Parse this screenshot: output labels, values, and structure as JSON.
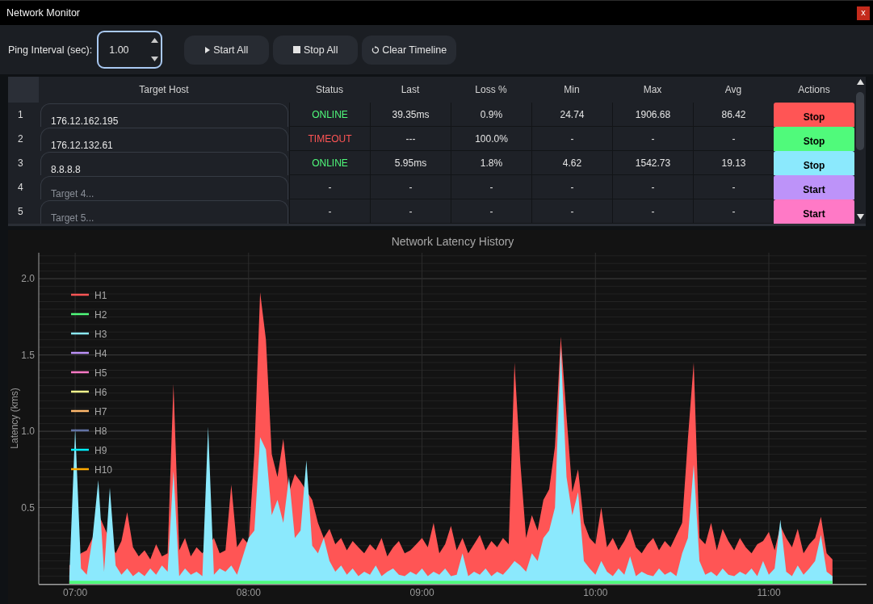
{
  "window": {
    "title": "Network Monitor",
    "close": "x"
  },
  "toolbar": {
    "interval": {
      "label": "Ping Interval (sec):",
      "value": "1.00",
      "focused": true
    },
    "buttons": [
      {
        "kind": "start",
        "label": "Start All"
      },
      {
        "kind": "stop",
        "label": "Stop All"
      },
      {
        "kind": "clear",
        "label": "Clear Timeline"
      }
    ]
  },
  "table": {
    "columns": [
      "Target Host",
      "Status",
      "Last",
      "Loss %",
      "Min",
      "Max",
      "Avg",
      "Actions"
    ],
    "rows": [
      {
        "number": "1",
        "host": "176.12.162.195",
        "status": {
          "text": "ONLINE",
          "color": "#50fa7b"
        },
        "last": "39.35ms",
        "loss": "0.9%",
        "min": "24.74",
        "max": "1906.68",
        "avg": "86.42",
        "action": "Stop",
        "color": "#ff5555"
      },
      {
        "number": "2",
        "host": "176.12.132.61",
        "status": {
          "text": "TIMEOUT",
          "color": "#ff5555"
        },
        "last": "---",
        "loss": "100.0%",
        "min": "-",
        "max": "-",
        "avg": "-",
        "action": "Stop",
        "color": "#50fa7b"
      },
      {
        "number": "3",
        "host": "8.8.8.8",
        "status": {
          "text": "ONLINE",
          "color": "#50fa7b"
        },
        "last": "5.95ms",
        "loss": "1.8%",
        "min": "4.62",
        "max": "1542.73",
        "avg": "19.13",
        "action": "Stop",
        "color": "#8be9fd"
      },
      {
        "number": "4",
        "placeholder": "Target 4...",
        "status": {
          "text": "-"
        },
        "last": "-",
        "loss": "-",
        "min": "-",
        "max": "-",
        "avg": "-",
        "action": "Start",
        "color": "#bd93f9"
      },
      {
        "number": "5",
        "placeholder": "Target 5...",
        "status": {
          "text": "-"
        },
        "last": "-",
        "loss": "-",
        "min": "-",
        "max": "-",
        "avg": "-",
        "action": "Start",
        "color": "#ff79c6"
      }
    ]
  },
  "chart": {
    "chart_data": {
      "type": "area",
      "title": "Network Latency History",
      "ylabel": "Latency (kms)",
      "grid": true,
      "legend": "upper left",
      "categories": [
        null,
        "07:00",
        null,
        null,
        null,
        null,
        null,
        null,
        null,
        null,
        null,
        null,
        null,
        null,
        null,
        null,
        null,
        null,
        null,
        null,
        null,
        null,
        null,
        null,
        null,
        null,
        null,
        null,
        null,
        null,
        null,
        "08:00",
        null,
        null,
        null,
        null,
        null,
        null,
        null,
        null,
        null,
        null,
        null,
        null,
        null,
        null,
        null,
        null,
        null,
        null,
        null,
        null,
        null,
        null,
        null,
        null,
        null,
        null,
        null,
        null,
        null,
        "09:00",
        null,
        null,
        null,
        null,
        null,
        null,
        null,
        null,
        null,
        null,
        null,
        null,
        null,
        null,
        null,
        null,
        null,
        null,
        null,
        null,
        null,
        null,
        null,
        null,
        null,
        null,
        null,
        null,
        null,
        "10:00",
        null,
        null,
        null,
        null,
        null,
        null,
        null,
        null,
        null,
        null,
        null,
        null,
        null,
        null,
        null,
        null,
        null,
        null,
        null,
        null,
        null,
        null,
        null,
        null,
        null,
        null,
        null,
        null,
        null,
        "11:00",
        null,
        null,
        null,
        null,
        null,
        null,
        null,
        null,
        null,
        null,
        null
      ],
      "series": [
        {
          "name": "H1",
          "color": "#ff5555",
          "values": [
            0.12,
            null,
            0.2,
            0.22,
            0.3,
            0.46,
            null,
            null,
            0.2,
            0.28,
            0.47,
            0.24,
            0.18,
            0.22,
            0.16,
            0.26,
            0.18,
            0.2,
            1.31,
            0.22,
            0.3,
            0.18,
            0.24,
            0.2,
            null,
            0.3,
            0.2,
            0.22,
            0.65,
            0.24,
            0.3,
            0.26,
            0.86,
            1.91,
            1.6,
            0.85,
            0.7,
            0.95,
            0.6,
            0.72,
            0.67,
            null,
            0.55,
            0.4,
            0.3,
            0.36,
            0.26,
            0.3,
            0.22,
            0.28,
            0.24,
            0.2,
            0.26,
            0.22,
            0.3,
            0.18,
            0.24,
            0.28,
            0.2,
            0.22,
            0.26,
            0.3,
            0.24,
            0.4,
            0.2,
            0.26,
            0.38,
            0.22,
            0.3,
            0.2,
            0.26,
            0.32,
            0.22,
            0.28,
            0.24,
            0.3,
            0.26,
            1.45,
            0.8,
            0.3,
            0.45,
            0.35,
            0.55,
            0.62,
            0.9,
            1.62,
            1.1,
            0.6,
            0.75,
            0.4,
            0.3,
            0.26,
            0.5,
            0.24,
            0.3,
            0.22,
            0.28,
            0.36,
            0.24,
            0.2,
            0.26,
            0.3,
            0.22,
            0.28,
            0.24,
            0.32,
            0.4,
            0.95,
            1.45,
            0.3,
            0.26,
            0.4,
            0.22,
            0.36,
            0.28,
            0.22,
            0.3,
            0.24,
            0.2,
            0.26,
            0.28,
            0.34,
            0.22,
            0.38,
            0.3,
            0.24,
            0.36,
            0.2,
            0.26,
            0.3,
            0.44,
            0.2,
            0.16
          ]
        },
        {
          "name": "H2",
          "color": "#50fa7b",
          "values": [
            0.02,
            0.02,
            0.02,
            0.02,
            0.02,
            0.02,
            0.02,
            0.02,
            0.02,
            0.02,
            0.02,
            0.02,
            0.02,
            0.02,
            0.02,
            0.02,
            0.02,
            0.02,
            0.02,
            0.02,
            0.02,
            0.02,
            0.02,
            0.02,
            0.02,
            0.02,
            0.02,
            0.02,
            0.02,
            0.02,
            0.02,
            0.02,
            0.02,
            0.02,
            0.02,
            0.02,
            0.02,
            0.02,
            0.02,
            0.02,
            0.02,
            0.02,
            0.02,
            0.02,
            0.02,
            0.02,
            0.02,
            0.02,
            0.02,
            0.02,
            0.02,
            0.02,
            0.02,
            0.02,
            0.02,
            0.02,
            0.02,
            0.02,
            0.02,
            0.02,
            0.02,
            0.02,
            0.02,
            0.02,
            0.02,
            0.02,
            0.02,
            0.02,
            0.02,
            0.02,
            0.02,
            0.02,
            0.02,
            0.02,
            0.02,
            0.02,
            0.02,
            0.02,
            0.02,
            0.02,
            0.02,
            0.02,
            0.02,
            0.02,
            0.02,
            0.02,
            0.02,
            0.02,
            0.02,
            0.02,
            0.02,
            0.02,
            0.02,
            0.02,
            0.02,
            0.02,
            0.02,
            0.02,
            0.02,
            0.02,
            0.02,
            0.02,
            0.02,
            0.02,
            0.02,
            0.02,
            0.02,
            0.02,
            0.02,
            0.02,
            0.02,
            0.02,
            0.02,
            0.02,
            0.02,
            0.02,
            0.02,
            0.02,
            0.02,
            0.02,
            0.02,
            0.02,
            0.02,
            0.02,
            0.02,
            0.02,
            0.02,
            0.02,
            0.02,
            0.02,
            0.02,
            0.02,
            0.02
          ]
        },
        {
          "name": "H3",
          "color": "#8be9fd",
          "values": [
            0.05,
            1.02,
            0.1,
            0.06,
            0.3,
            0.68,
            0.08,
            0.63,
            0.12,
            0.06,
            0.1,
            0.05,
            0.08,
            0.05,
            0.1,
            0.06,
            0.12,
            0.08,
            0.74,
            0.05,
            0.1,
            0.06,
            0.08,
            0.05,
            1.03,
            0.06,
            0.1,
            0.08,
            0.12,
            0.06,
            0.18,
            0.3,
            0.35,
            0.96,
            0.88,
            0.45,
            0.55,
            0.4,
            0.7,
            0.3,
            0.35,
            0.81,
            0.25,
            0.2,
            0.3,
            0.15,
            0.08,
            0.12,
            0.06,
            0.1,
            0.05,
            0.08,
            0.06,
            0.12,
            0.05,
            0.08,
            0.1,
            0.06,
            0.05,
            0.08,
            0.06,
            0.1,
            0.05,
            0.08,
            0.06,
            0.1,
            0.05,
            0.06,
            0.2,
            0.05,
            0.08,
            0.06,
            0.1,
            0.05,
            0.08,
            0.06,
            0.1,
            0.15,
            0.12,
            0.08,
            0.2,
            0.15,
            0.3,
            0.35,
            0.5,
            1.55,
            0.7,
            0.45,
            0.6,
            0.15,
            0.1,
            0.06,
            0.15,
            0.08,
            0.05,
            0.1,
            0.06,
            0.18,
            0.05,
            0.08,
            0.06,
            0.05,
            0.1,
            0.06,
            0.08,
            0.05,
            0.2,
            0.3,
            0.78,
            0.15,
            0.06,
            0.08,
            0.05,
            0.1,
            0.06,
            0.05,
            0.08,
            0.06,
            0.1,
            0.05,
            0.15,
            0.06,
            0.1,
            0.42,
            0.08,
            0.05,
            0.12,
            0.06,
            0.1,
            0.15,
            0.32,
            0.08,
            0.05
          ]
        },
        {
          "name": "H4",
          "color": "#bd93f9",
          "values": [
            null,
            null,
            null,
            null,
            null,
            null,
            null,
            null,
            null,
            null,
            null,
            null,
            null,
            null,
            null,
            null,
            null,
            null,
            null,
            null,
            null,
            null,
            null,
            null,
            null,
            null,
            null,
            null,
            null,
            null,
            null,
            null,
            null,
            null,
            null,
            null,
            null,
            null,
            null,
            null,
            null,
            null,
            null,
            null,
            null,
            null,
            null,
            null,
            null,
            null,
            null,
            null,
            null,
            null,
            null,
            null,
            null,
            null,
            null,
            null,
            null,
            null,
            null,
            null,
            null,
            null,
            null,
            null,
            null,
            null,
            null,
            null,
            null,
            null,
            null,
            null,
            null,
            null,
            null,
            null,
            null,
            null,
            null,
            null,
            null,
            null,
            null,
            null,
            null,
            null,
            null,
            null,
            null,
            null,
            null,
            null,
            null,
            null,
            null,
            null,
            null,
            null,
            null,
            null,
            null,
            null,
            null,
            null,
            null,
            null,
            null,
            null,
            null,
            null,
            null,
            null,
            null,
            null,
            null,
            null,
            null,
            null,
            null,
            null,
            null,
            null,
            null,
            null,
            null,
            null,
            null,
            null,
            null
          ]
        },
        {
          "name": "H5",
          "color": "#ff79c6",
          "values": [
            null,
            null,
            null,
            null,
            null,
            null,
            null,
            null,
            null,
            null,
            null,
            null,
            null,
            null,
            null,
            null,
            null,
            null,
            null,
            null,
            null,
            null,
            null,
            null,
            null,
            null,
            null,
            null,
            null,
            null,
            null,
            null,
            null,
            null,
            null,
            null,
            null,
            null,
            null,
            null,
            null,
            null,
            null,
            null,
            null,
            null,
            null,
            null,
            null,
            null,
            null,
            null,
            null,
            null,
            null,
            null,
            null,
            null,
            null,
            null,
            null,
            null,
            null,
            null,
            null,
            null,
            null,
            null,
            null,
            null,
            null,
            null,
            null,
            null,
            null,
            null,
            null,
            null,
            null,
            null,
            null,
            null,
            null,
            null,
            null,
            null,
            null,
            null,
            null,
            null,
            null,
            null,
            null,
            null,
            null,
            null,
            null,
            null,
            null,
            null,
            null,
            null,
            null,
            null,
            null,
            null,
            null,
            null,
            null,
            null,
            null,
            null,
            null,
            null,
            null,
            null,
            null,
            null,
            null,
            null,
            null,
            null,
            null,
            null,
            null,
            null,
            null,
            null,
            null,
            null,
            null,
            null,
            null
          ]
        },
        {
          "name": "H6",
          "color": "#f1fa8c",
          "values": [
            null,
            null,
            null,
            null,
            null,
            null,
            null,
            null,
            null,
            null,
            null,
            null,
            null,
            null,
            null,
            null,
            null,
            null,
            null,
            null,
            null,
            null,
            null,
            null,
            null,
            null,
            null,
            null,
            null,
            null,
            null,
            null,
            null,
            null,
            null,
            null,
            null,
            null,
            null,
            null,
            null,
            null,
            null,
            null,
            null,
            null,
            null,
            null,
            null,
            null,
            null,
            null,
            null,
            null,
            null,
            null,
            null,
            null,
            null,
            null,
            null,
            null,
            null,
            null,
            null,
            null,
            null,
            null,
            null,
            null,
            null,
            null,
            null,
            null,
            null,
            null,
            null,
            null,
            null,
            null,
            null,
            null,
            null,
            null,
            null,
            null,
            null,
            null,
            null,
            null,
            null,
            null,
            null,
            null,
            null,
            null,
            null,
            null,
            null,
            null,
            null,
            null,
            null,
            null,
            null,
            null,
            null,
            null,
            null,
            null,
            null,
            null,
            null,
            null,
            null,
            null,
            null,
            null,
            null,
            null,
            null,
            null,
            null,
            null,
            null,
            null,
            null,
            null,
            null,
            null,
            null,
            null,
            null
          ]
        },
        {
          "name": "H7",
          "color": "#ffb86c",
          "values": [
            null,
            null,
            null,
            null,
            null,
            null,
            null,
            null,
            null,
            null,
            null,
            null,
            null,
            null,
            null,
            null,
            null,
            null,
            null,
            null,
            null,
            null,
            null,
            null,
            null,
            null,
            null,
            null,
            null,
            null,
            null,
            null,
            null,
            null,
            null,
            null,
            null,
            null,
            null,
            null,
            null,
            null,
            null,
            null,
            null,
            null,
            null,
            null,
            null,
            null,
            null,
            null,
            null,
            null,
            null,
            null,
            null,
            null,
            null,
            null,
            null,
            null,
            null,
            null,
            null,
            null,
            null,
            null,
            null,
            null,
            null,
            null,
            null,
            null,
            null,
            null,
            null,
            null,
            null,
            null,
            null,
            null,
            null,
            null,
            null,
            null,
            null,
            null,
            null,
            null,
            null,
            null,
            null,
            null,
            null,
            null,
            null,
            null,
            null,
            null,
            null,
            null,
            null,
            null,
            null,
            null,
            null,
            null,
            null,
            null,
            null,
            null,
            null,
            null,
            null,
            null,
            null,
            null,
            null,
            null,
            null,
            null,
            null,
            null,
            null,
            null,
            null,
            null,
            null,
            null,
            null,
            null,
            null
          ]
        },
        {
          "name": "H8",
          "color": "#6272a4",
          "values": [
            null,
            null,
            null,
            null,
            null,
            null,
            null,
            null,
            null,
            null,
            null,
            null,
            null,
            null,
            null,
            null,
            null,
            null,
            null,
            null,
            null,
            null,
            null,
            null,
            null,
            null,
            null,
            null,
            null,
            null,
            null,
            null,
            null,
            null,
            null,
            null,
            null,
            null,
            null,
            null,
            null,
            null,
            null,
            null,
            null,
            null,
            null,
            null,
            null,
            null,
            null,
            null,
            null,
            null,
            null,
            null,
            null,
            null,
            null,
            null,
            null,
            null,
            null,
            null,
            null,
            null,
            null,
            null,
            null,
            null,
            null,
            null,
            null,
            null,
            null,
            null,
            null,
            null,
            null,
            null,
            null,
            null,
            null,
            null,
            null,
            null,
            null,
            null,
            null,
            null,
            null,
            null,
            null,
            null,
            null,
            null,
            null,
            null,
            null,
            null,
            null,
            null,
            null,
            null,
            null,
            null,
            null,
            null,
            null,
            null,
            null,
            null,
            null,
            null,
            null,
            null,
            null,
            null,
            null,
            null,
            null,
            null,
            null,
            null,
            null,
            null,
            null,
            null,
            null,
            null,
            null,
            null,
            null
          ]
        },
        {
          "name": "H9",
          "color": "#00f0ff",
          "values": [
            null,
            null,
            null,
            null,
            null,
            null,
            null,
            null,
            null,
            null,
            null,
            null,
            null,
            null,
            null,
            null,
            null,
            null,
            null,
            null,
            null,
            null,
            null,
            null,
            null,
            null,
            null,
            null,
            null,
            null,
            null,
            null,
            null,
            null,
            null,
            null,
            null,
            null,
            null,
            null,
            null,
            null,
            null,
            null,
            null,
            null,
            null,
            null,
            null,
            null,
            null,
            null,
            null,
            null,
            null,
            null,
            null,
            null,
            null,
            null,
            null,
            null,
            null,
            null,
            null,
            null,
            null,
            null,
            null,
            null,
            null,
            null,
            null,
            null,
            null,
            null,
            null,
            null,
            null,
            null,
            null,
            null,
            null,
            null,
            null,
            null,
            null,
            null,
            null,
            null,
            null,
            null,
            null,
            null,
            null,
            null,
            null,
            null,
            null,
            null,
            null,
            null,
            null,
            null,
            null,
            null,
            null,
            null,
            null,
            null,
            null,
            null,
            null,
            null,
            null,
            null,
            null,
            null,
            null,
            null,
            null,
            null,
            null,
            null,
            null,
            null,
            null,
            null,
            null,
            null,
            null,
            null,
            null
          ]
        },
        {
          "name": "H10",
          "color": "#ffaa00",
          "values": [
            null,
            null,
            null,
            null,
            null,
            null,
            null,
            null,
            null,
            null,
            null,
            null,
            null,
            null,
            null,
            null,
            null,
            null,
            null,
            null,
            null,
            null,
            null,
            null,
            null,
            null,
            null,
            null,
            null,
            null,
            null,
            null,
            null,
            null,
            null,
            null,
            null,
            null,
            null,
            null,
            null,
            null,
            null,
            null,
            null,
            null,
            null,
            null,
            null,
            null,
            null,
            null,
            null,
            null,
            null,
            null,
            null,
            null,
            null,
            null,
            null,
            null,
            null,
            null,
            null,
            null,
            null,
            null,
            null,
            null,
            null,
            null,
            null,
            null,
            null,
            null,
            null,
            null,
            null,
            null,
            null,
            null,
            null,
            null,
            null,
            null,
            null,
            null,
            null,
            null,
            null,
            null,
            null,
            null,
            null,
            null,
            null,
            null,
            null,
            null,
            null,
            null,
            null,
            null,
            null,
            null,
            null,
            null,
            null,
            null,
            null,
            null,
            null,
            null,
            null,
            null,
            null,
            null,
            null,
            null,
            null,
            null,
            null,
            null,
            null,
            null,
            null,
            null,
            null,
            null,
            null,
            null,
            null
          ]
        }
      ],
      "ylim": [
        0,
        2.17
      ],
      "yticks": [
        {
          "value": 0.5,
          "label": "0.5"
        },
        {
          "value": 1,
          "label": "1.0"
        },
        {
          "value": 1.5,
          "label": "1.5"
        },
        {
          "value": 2,
          "label": "2.0"
        }
      ]
    }
  }
}
